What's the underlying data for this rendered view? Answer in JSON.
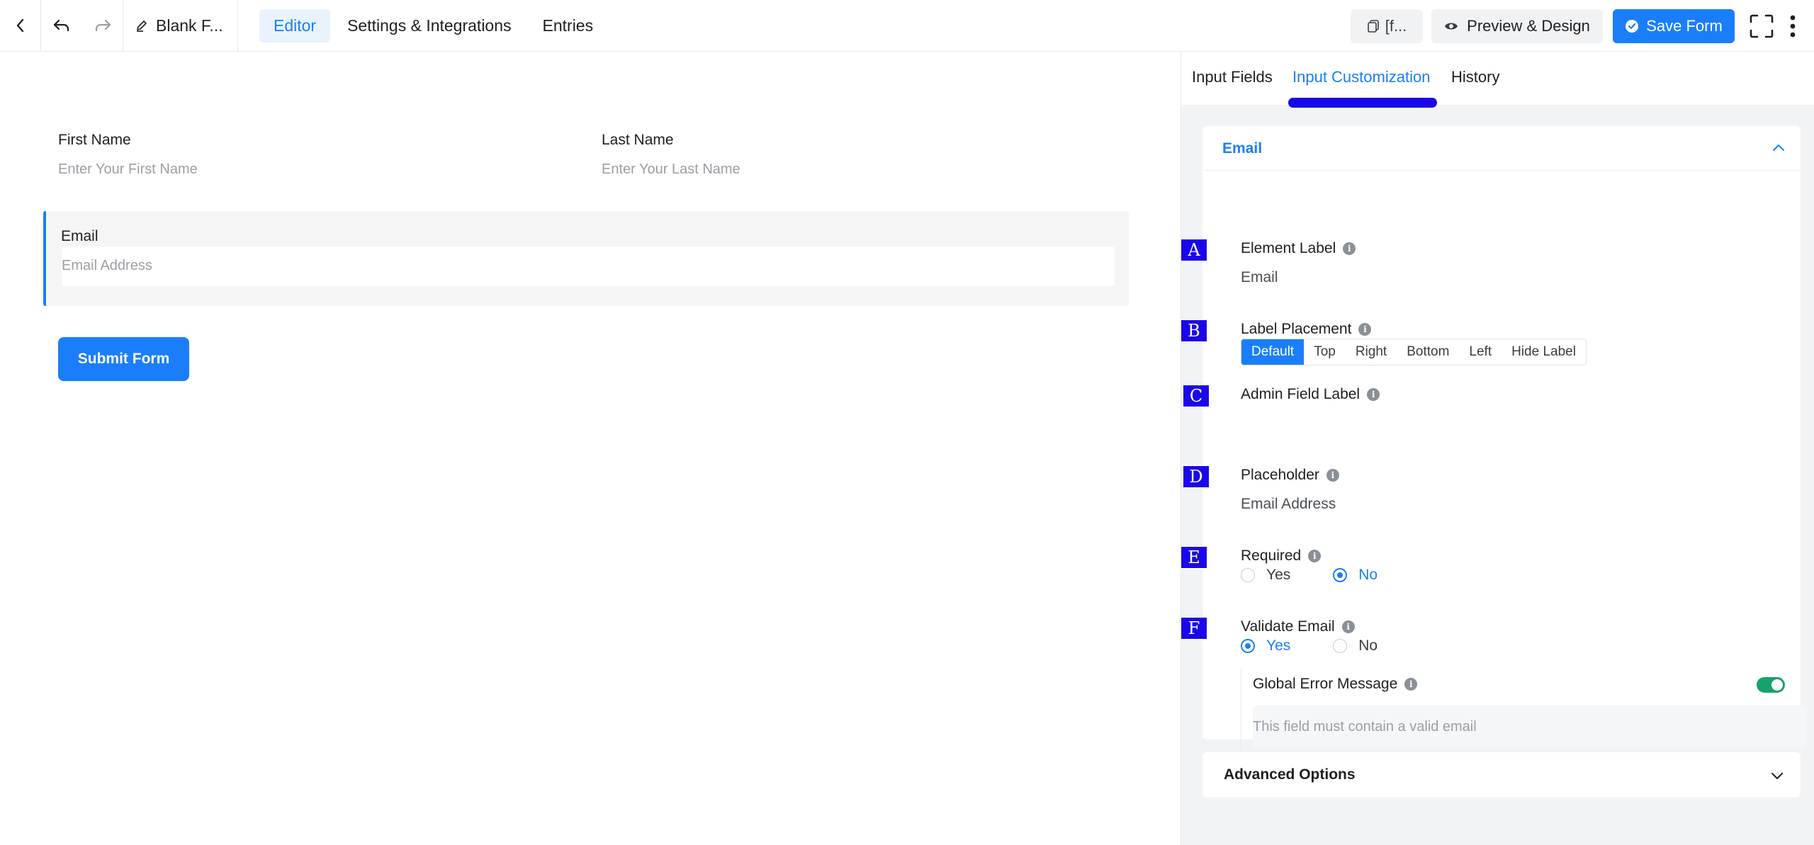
{
  "topbar": {
    "title": "Blank F...",
    "tabs": [
      {
        "label": "Editor",
        "active": true
      },
      {
        "label": "Settings & Integrations",
        "active": false
      },
      {
        "label": "Entries",
        "active": false
      }
    ],
    "shortcode_label": "[f...",
    "preview_label": "Preview & Design",
    "save_label": "Save Form"
  },
  "form": {
    "first_name": {
      "label": "First Name",
      "placeholder": "Enter Your First Name"
    },
    "last_name": {
      "label": "Last Name",
      "placeholder": "Enter Your Last Name"
    },
    "email": {
      "label": "Email",
      "placeholder": "Email Address"
    },
    "submit_label": "Submit Form"
  },
  "panel": {
    "tabs": [
      {
        "label": "Input Fields",
        "active": false
      },
      {
        "label": "Input Customization",
        "active": true
      },
      {
        "label": "History",
        "active": false
      }
    ],
    "card_title": "Email",
    "markers": [
      "A",
      "B",
      "C",
      "D",
      "E",
      "F"
    ],
    "element_label": {
      "label": "Element Label",
      "value": "Email"
    },
    "label_placement": {
      "label": "Label Placement",
      "options": [
        "Default",
        "Top",
        "Right",
        "Bottom",
        "Left",
        "Hide Label"
      ],
      "selected": "Default"
    },
    "admin_field_label": {
      "label": "Admin Field Label",
      "value": ""
    },
    "placeholder": {
      "label": "Placeholder",
      "value": "Email Address"
    },
    "required": {
      "label": "Required",
      "yes": "Yes",
      "no": "No",
      "selected": "No"
    },
    "validate_email": {
      "label": "Validate Email",
      "yes": "Yes",
      "no": "No",
      "selected": "Yes"
    },
    "global_error": {
      "label": "Global Error Message",
      "enabled": true,
      "placeholder": "This field must contain a valid email"
    },
    "advanced_title": "Advanced Options"
  },
  "colors": {
    "accent": "#1a7efb",
    "marker": "#1a06ea",
    "toggle_on": "#16a36b"
  }
}
